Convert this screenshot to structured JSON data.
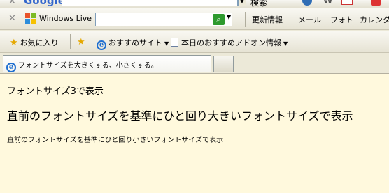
{
  "google_toolbar": {
    "brand": "Google",
    "search_label": "検索"
  },
  "live_toolbar": {
    "label": "Windows Live",
    "search_value": "",
    "menu": [
      "更新情報",
      "メール",
      "フォト",
      "カレンダー"
    ]
  },
  "links_bar": {
    "favorites": "お気に入り",
    "items": [
      {
        "label": "おすすめサイト",
        "icon": "ie-icon"
      },
      {
        "label": "本日のおすすめアドオン情報",
        "icon": "page-icon"
      }
    ]
  },
  "tabs": [
    {
      "title": "フォントサイズを大きくする、小さくする。"
    }
  ],
  "content": {
    "lines": [
      "フォントサイズ3で表示",
      "直前のフォントサイズを基準にひと回り大きいフォントサイズで表示",
      "直前のフォントサイズを基準にひと回り小さいフォントサイズで表示"
    ]
  },
  "colors": {
    "content_background": "#fff9dd",
    "chrome": "#ece9d8"
  }
}
